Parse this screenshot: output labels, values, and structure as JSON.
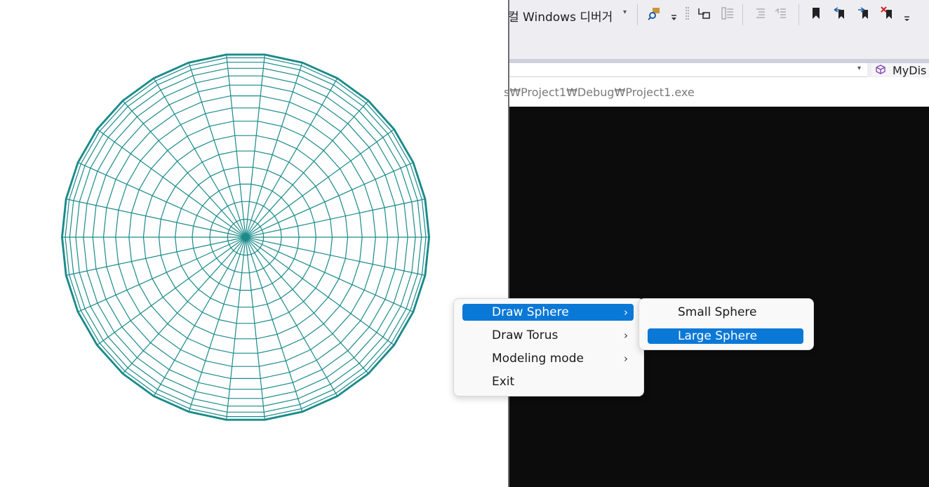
{
  "ide": {
    "debugger_label": "컬 Windows 디버거",
    "member_combo_text": "MyDis",
    "console_path": "s₩Project1₩Debug₩Project1.exe"
  },
  "context_menu": {
    "items": [
      {
        "label": "Draw Sphere",
        "has_submenu": true,
        "selected": true
      },
      {
        "label": "Draw Torus",
        "has_submenu": true,
        "selected": false
      },
      {
        "label": "Modeling mode",
        "has_submenu": true,
        "selected": false
      },
      {
        "label": "Exit",
        "has_submenu": false,
        "selected": false
      }
    ],
    "chevron": "›"
  },
  "submenu": {
    "items": [
      {
        "label": "Small Sphere",
        "selected": false
      },
      {
        "label": "Large Sphere",
        "selected": true
      }
    ]
  },
  "glyphs": {
    "dropdown_arrow": "▾"
  },
  "colors": {
    "wireframe": "#1a8a8a",
    "menu_highlight": "#0a78d7",
    "console_bg": "#0c0c0c"
  }
}
